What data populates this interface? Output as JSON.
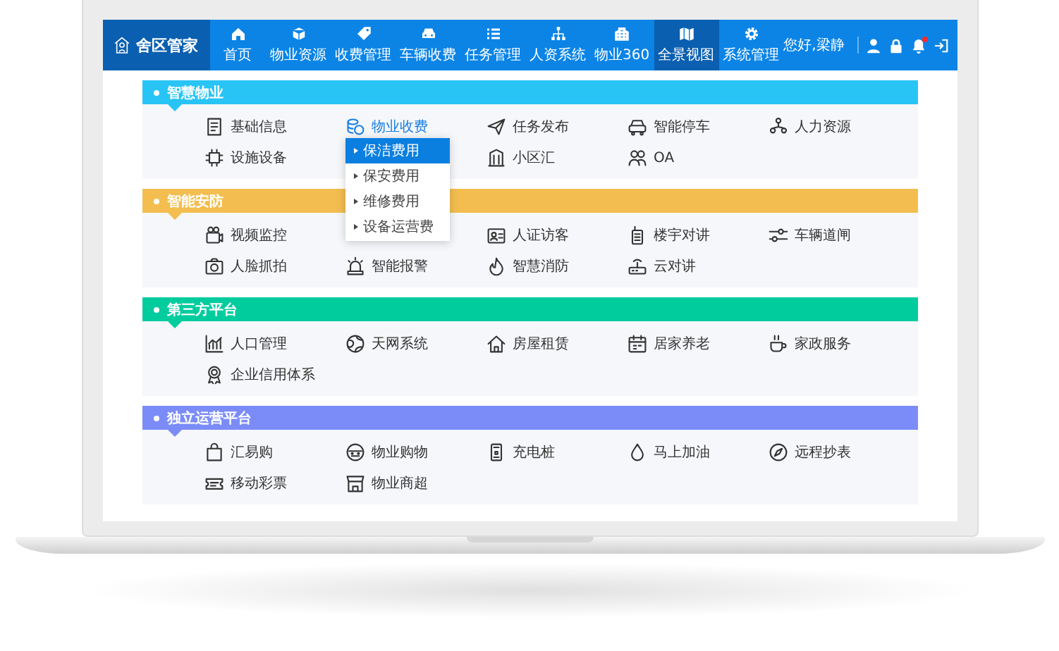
{
  "app": {
    "logo_text": "舍区管家",
    "greeting": "您好,梁静",
    "notifications_unread": true
  },
  "nav": [
    {
      "label": "首页",
      "selected": false
    },
    {
      "label": "物业资源",
      "selected": false
    },
    {
      "label": "收费管理",
      "selected": false
    },
    {
      "label": "车辆收费",
      "selected": false
    },
    {
      "label": "任务管理",
      "selected": false
    },
    {
      "label": "人资系统",
      "selected": false
    },
    {
      "label": "物业360",
      "selected": false
    },
    {
      "label": "全景视图",
      "selected": true
    },
    {
      "label": "系统管理",
      "selected": false
    }
  ],
  "sections": [
    {
      "title": "智慧物业",
      "color": "#29c4f6",
      "items": [
        {
          "kind": "item",
          "label": "基础信息",
          "selected": false
        },
        {
          "kind": "item",
          "label": "物业收费",
          "selected": true,
          "dropdown": [
            {
              "label": "保洁费用",
              "selected": true
            },
            {
              "label": "保安费用",
              "selected": false
            },
            {
              "label": "维修费用",
              "selected": false
            },
            {
              "label": "设备运营费",
              "selected": false
            }
          ]
        },
        {
          "kind": "item",
          "label": "任务发布",
          "selected": false
        },
        {
          "kind": "item",
          "label": "智能停车",
          "selected": false
        },
        {
          "kind": "item",
          "label": "人力资源",
          "selected": false
        },
        {
          "kind": "item",
          "label": "设施设备",
          "selected": false
        },
        {
          "kind": "covered"
        },
        {
          "kind": "item",
          "label": "小区汇",
          "selected": false
        },
        {
          "kind": "item",
          "label": "OA",
          "selected": false
        }
      ]
    },
    {
      "title": "智能安防",
      "color": "#f3be4f",
      "items": [
        {
          "kind": "item",
          "label": "视频监控",
          "selected": false
        },
        {
          "kind": "covered"
        },
        {
          "kind": "item",
          "label": "人证访客",
          "selected": false
        },
        {
          "kind": "item",
          "label": "楼宇对讲",
          "selected": false
        },
        {
          "kind": "item",
          "label": "车辆道闸",
          "selected": false
        },
        {
          "kind": "item",
          "label": "人脸抓拍",
          "selected": false
        },
        {
          "kind": "item",
          "label": "智能报警",
          "selected": false
        },
        {
          "kind": "item",
          "label": "智慧消防",
          "selected": false
        },
        {
          "kind": "item",
          "label": "云对讲",
          "selected": false
        }
      ]
    },
    {
      "title": "第三方平台",
      "color": "#00cc9e",
      "items": [
        {
          "kind": "item",
          "label": "人口管理",
          "selected": false
        },
        {
          "kind": "item",
          "label": "天网系统",
          "selected": false
        },
        {
          "kind": "item",
          "label": "房屋租赁",
          "selected": false
        },
        {
          "kind": "item",
          "label": "居家养老",
          "selected": false
        },
        {
          "kind": "item",
          "label": "家政服务",
          "selected": false
        },
        {
          "kind": "item",
          "label": "企业信用体系",
          "selected": false
        }
      ]
    },
    {
      "title": "独立运营平台",
      "color": "#7b8cf8",
      "items": [
        {
          "kind": "item",
          "label": "汇易购",
          "selected": false
        },
        {
          "kind": "item",
          "label": "物业购物",
          "selected": false
        },
        {
          "kind": "item",
          "label": "充电桩",
          "selected": false
        },
        {
          "kind": "item",
          "label": "马上加油",
          "selected": false
        },
        {
          "kind": "item",
          "label": "远程抄表",
          "selected": false
        },
        {
          "kind": "item",
          "label": "移动彩票",
          "selected": false
        },
        {
          "kind": "item",
          "label": "物业商超",
          "selected": false
        }
      ]
    }
  ]
}
